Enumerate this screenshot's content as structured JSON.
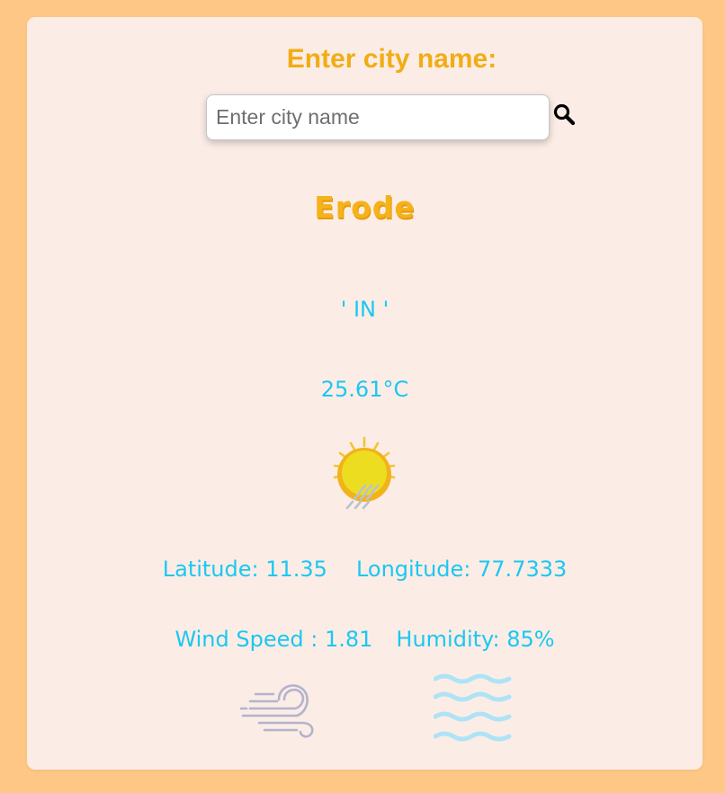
{
  "search": {
    "heading": "Enter city name:",
    "placeholder": "Enter city name",
    "value": "",
    "button_icon": "search-icon"
  },
  "weather": {
    "city": "Erode",
    "country": "' IN '",
    "temperature": "25.61°C",
    "condition_icon": "sun-rain-icon",
    "latitude": "Latitude: 11.35",
    "longitude": "Longitude: 77.7333",
    "wind_speed": "Wind Speed : 1.81",
    "humidity": "Humidity: 85%",
    "wind_icon": "wind-icon",
    "humidity_icon": "humidity-waves-icon"
  },
  "colors": {
    "page_background": "#ffc785",
    "card_background": "#fbede6",
    "accent_orange": "#f2ac14",
    "accent_blue": "#1cc7f1"
  }
}
